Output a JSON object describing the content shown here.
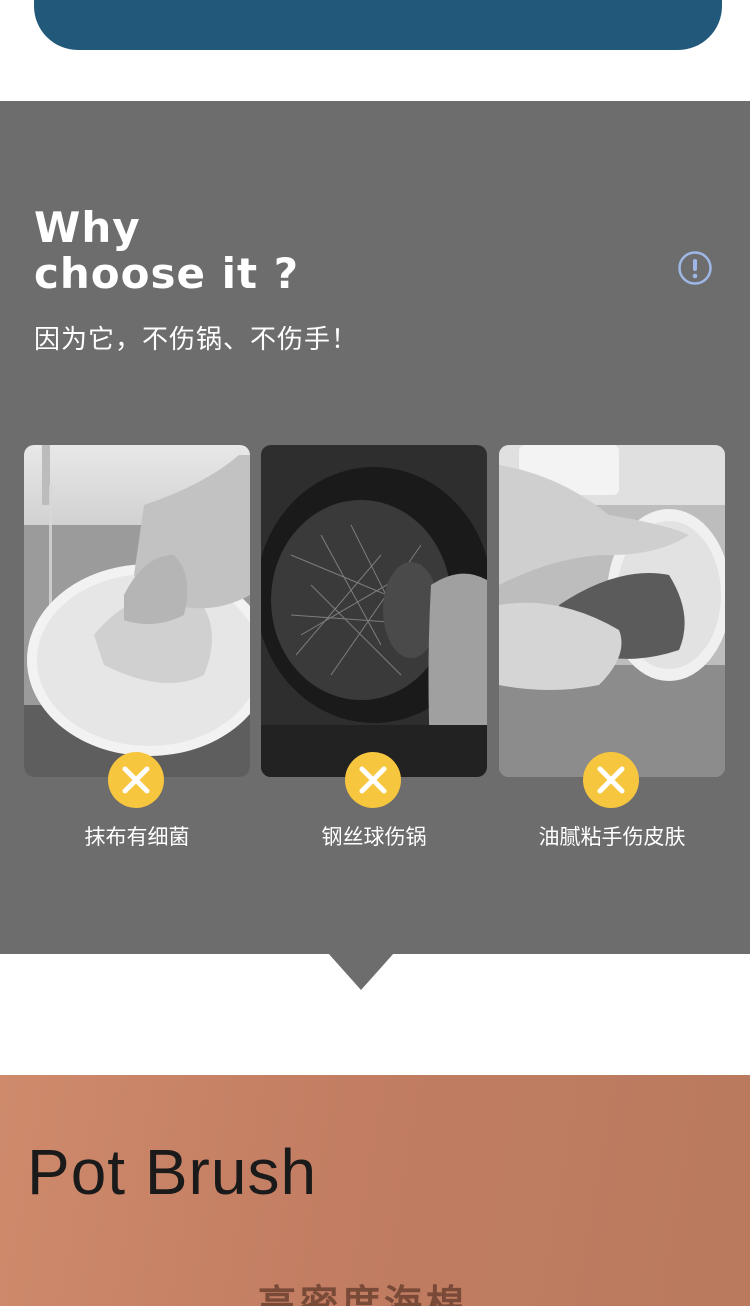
{
  "why": {
    "title_line1": "Why",
    "title_line2": "choose it ?",
    "subtitle": "因为它，不伤锅、不伤手！",
    "icon": "exclamation-circle-icon"
  },
  "cards": [
    {
      "label": "抹布有细菌",
      "icon": "x-icon"
    },
    {
      "label": "钢丝球伤锅",
      "icon": "x-icon"
    },
    {
      "label": "油腻粘手伤皮肤",
      "icon": "x-icon"
    }
  ],
  "product": {
    "title": "Pot Brush",
    "subtitle": "高密度海棉"
  },
  "colors": {
    "banner": "#22587a",
    "section_bg": "#6d6d6d",
    "badge": "#f7c63f",
    "product_bg": "#c58065"
  }
}
